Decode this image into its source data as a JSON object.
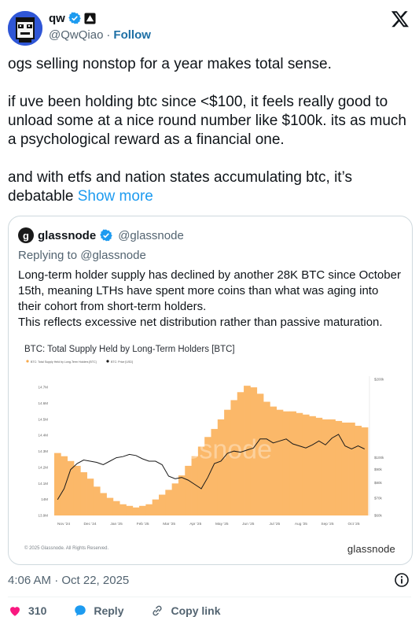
{
  "author": {
    "display_name": "qw",
    "handle": "@QwQiao",
    "follow_label": "Follow",
    "avatar_icon": "pixel-face-avatar"
  },
  "tweet": {
    "paragraph1": "ogs selling nonstop for a year makes total sense.",
    "paragraph2": "if uve been holding btc since <$100, it feels really good to unload some at a nice round number like $100k. its as much a psychological reward as a financial one.",
    "paragraph3": "and with etfs and nation states accumulating btc, it’s debatable",
    "show_more": "Show more"
  },
  "quote": {
    "display_name": "glassnode",
    "handle": "@glassnode",
    "replying_to": "Replying to @glassnode",
    "line1": "Long-term holder supply has declined by another 28K BTC since October 15th, meaning LTHs have spent more coins than what was aging into their cohort from short-term holders.",
    "line2": "This reflects excessive net distribution rather than passive maturation."
  },
  "chart_data": {
    "type": "area",
    "title": "BTC: Total Supply Held by Long-Term Holders [BTC]",
    "legend": [
      "BTC: Total Supply Held by Long-Term Holders [BTC]",
      "BTC: Price [USD]"
    ],
    "watermark": "glassnode",
    "copyright": "© 2025 Glassnode. All Rights Reserved.",
    "brand": "glassnode",
    "x_ticks": [
      "Nov '24",
      "Dec '24",
      "Jan '25",
      "Feb '25",
      "Mar '25",
      "Apr '25",
      "May '25",
      "Jun '25",
      "Jul '25",
      "Aug '25",
      "Sep '25",
      "Oct '25"
    ],
    "left_axis_ticks": [
      "14.7M",
      "14.6M",
      "14.5M",
      "14.4M",
      "14.3M",
      "14.2M",
      "14.1M",
      "14M",
      "13.9M"
    ],
    "right_axis_ticks": [
      "$200k",
      "$100k",
      "$90k",
      "$80k",
      "$70k",
      "$60k"
    ],
    "ylim_left": [
      13.9,
      14.75
    ],
    "ylim_right": [
      60000,
      200000
    ],
    "colors": {
      "supply": "#f7a94a",
      "supply_fill": "#fbb869",
      "price": "#1a1a1a"
    },
    "series": [
      {
        "name": "BTC: Total Supply Held by Long-Term Holders [BTC]",
        "values": [
          14.29,
          14.27,
          14.24,
          14.21,
          14.17,
          14.13,
          14.08,
          14.04,
          14.01,
          13.99,
          13.97,
          13.96,
          13.95,
          13.96,
          13.97,
          14.0,
          14.03,
          14.06,
          14.1,
          14.15,
          14.21,
          14.27,
          14.33,
          14.39,
          14.44,
          14.5,
          14.56,
          14.62,
          14.67,
          14.71,
          14.7,
          14.66,
          14.61,
          14.58,
          14.56,
          14.55,
          14.55,
          14.54,
          14.53,
          14.52,
          14.51,
          14.5,
          14.5,
          14.49,
          14.48,
          14.48,
          14.46,
          14.45
        ]
      },
      {
        "name": "BTC: Price [USD]",
        "values": [
          69000,
          76000,
          90000,
          95000,
          98000,
          97000,
          96000,
          94000,
          97000,
          100000,
          101000,
          103000,
          102000,
          99000,
          97000,
          97000,
          94000,
          85000,
          83000,
          84000,
          82000,
          79000,
          76000,
          84000,
          95000,
          97000,
          104000,
          106000,
          105000,
          107000,
          109000,
          118000,
          118000,
          114000,
          116000,
          118000,
          113000,
          111000,
          109000,
          112000,
          116000,
          112000,
          119000,
          123000,
          111000,
          108000,
          111000,
          108000
        ]
      }
    ]
  },
  "footer": {
    "timestamp": "4:06 AM · Oct 22, 2025",
    "likes": "310",
    "reply_label": "Reply",
    "copy_link_label": "Copy link"
  }
}
